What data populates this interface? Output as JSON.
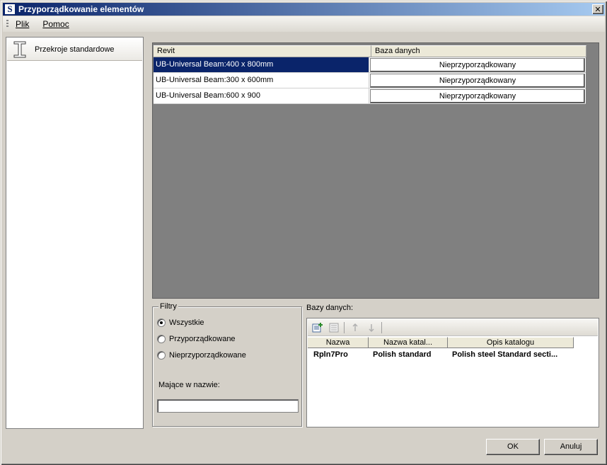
{
  "window": {
    "title": "Przyporządkowanie elementów",
    "icon_letter": "S",
    "close_glyph": "✕"
  },
  "menu": {
    "file": "Plik",
    "help": "Pomoc"
  },
  "sidebar": {
    "items": [
      {
        "label": "Przekroje standardowe",
        "icon": "i-beam-icon"
      }
    ]
  },
  "grid": {
    "columns": [
      "Revit",
      "Baza danych"
    ],
    "rows": [
      {
        "revit": "UB-Universal Beam:400 x 800mm",
        "db": "Nieprzyporządkowany",
        "selected": true
      },
      {
        "revit": "UB-Universal Beam:300 x 600mm",
        "db": "Nieprzyporządkowany",
        "selected": false
      },
      {
        "revit": "UB-Universal Beam:600 x 900",
        "db": "Nieprzyporządkowany",
        "selected": false
      }
    ]
  },
  "filters": {
    "title": "Filtry",
    "options": [
      "Wszystkie",
      "Przyporządkowane",
      "Nieprzyporządkowane"
    ],
    "selected_index": 0,
    "name_label": "Mające w nazwie:",
    "name_value": ""
  },
  "databases": {
    "label": "Bazy danych:",
    "columns": [
      "Nazwa",
      "Nazwa katal...",
      "Opis katalogu"
    ],
    "rows": [
      {
        "name": "Rpln7Pro",
        "catalog": "Polish standard",
        "description": "Polish steel Standard secti..."
      }
    ]
  },
  "buttons": {
    "ok": "OK",
    "cancel": "Anuluj"
  },
  "colors": {
    "title_bar": "#0a246a",
    "selection": "#0a246a",
    "grid_background": "#808080"
  }
}
